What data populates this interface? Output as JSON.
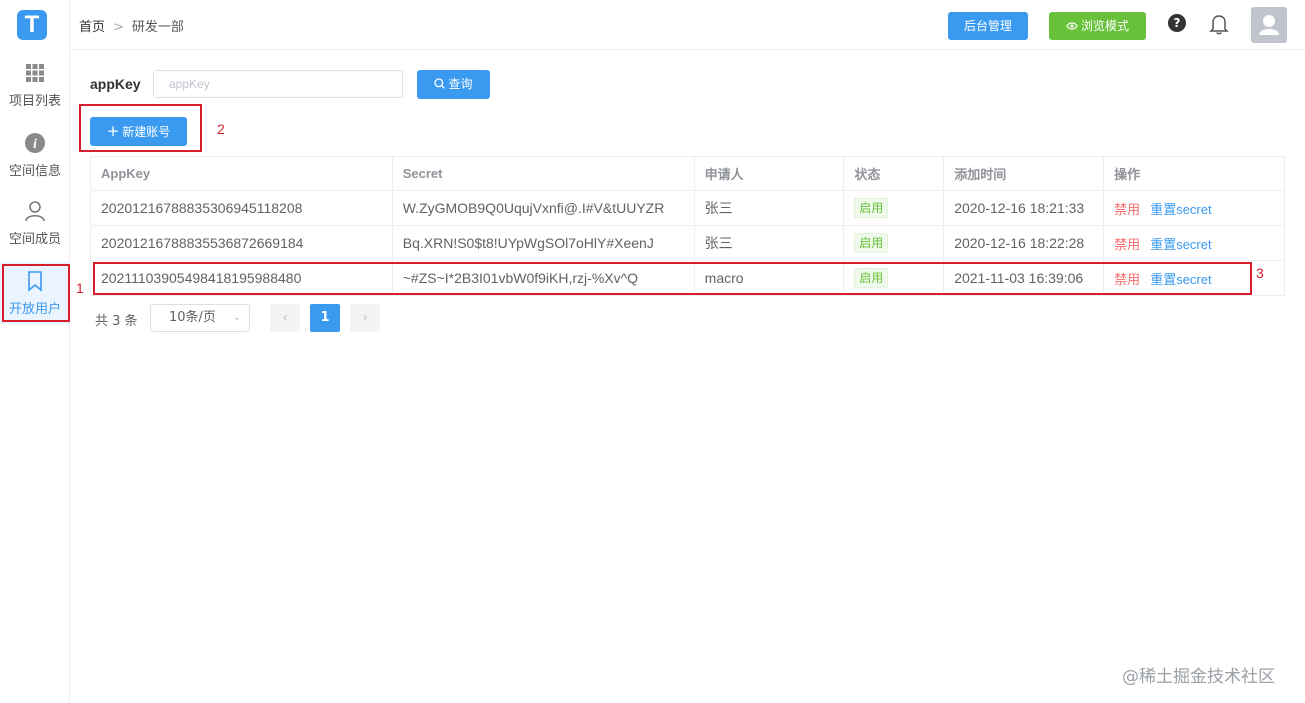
{
  "app": {
    "logo_letter": "T"
  },
  "sidebar": {
    "items": [
      {
        "label": "项目列表",
        "icon": "grid-icon"
      },
      {
        "label": "空间信息",
        "icon": "info-icon"
      },
      {
        "label": "空间成员",
        "icon": "user-icon"
      },
      {
        "label": "开放用户",
        "icon": "bookmark-icon",
        "active": true
      }
    ]
  },
  "header": {
    "breadcrumb": [
      "首页",
      "研发一部"
    ],
    "admin_label": "后台管理",
    "browse_label": "浏览模式",
    "help_glyph": "?"
  },
  "search": {
    "label": "appKey",
    "placeholder": "appKey",
    "query_label": "查询"
  },
  "toolbar": {
    "new_label": "新建账号"
  },
  "table": {
    "columns": [
      "AppKey",
      "Secret",
      "申请人",
      "状态",
      "添加时间",
      "操作"
    ],
    "rows": [
      {
        "appkey": "20201216788835306945118208",
        "secret": "W.ZyGMOB9Q0UqujVxnfi@.I#V&tUUYZR",
        "applicant": "张三",
        "status": "启用",
        "added": "2020-12-16 18:21:33",
        "disable": "禁用",
        "reset": "重置secret"
      },
      {
        "appkey": "20201216788835536872669184",
        "secret": "Bq.XRN!S0$t8!UYpWgSOl7oHlY#XeenJ",
        "applicant": "张三",
        "status": "启用",
        "added": "2020-12-16 18:22:28",
        "disable": "禁用",
        "reset": "重置secret"
      },
      {
        "appkey": "20211103905498418195988480",
        "secret": "~#ZS~I*2B3I01vbW0f9iKH,rzj-%Xv^Q",
        "applicant": "macro",
        "status": "启用",
        "added": "2021-11-03 16:39:06",
        "disable": "禁用",
        "reset": "重置secret"
      }
    ]
  },
  "pagination": {
    "total_text": "共 3 条",
    "page_size": "10条/页",
    "current_page": "1",
    "prev": "‹",
    "next": "›"
  },
  "annotations": [
    "1",
    "2",
    "3"
  ],
  "watermark": "@稀土掘金技术社区",
  "colors": {
    "primary": "#3a9af0",
    "success": "#67c23a",
    "danger": "#f56c6c",
    "annotation": "#d81e2a"
  }
}
